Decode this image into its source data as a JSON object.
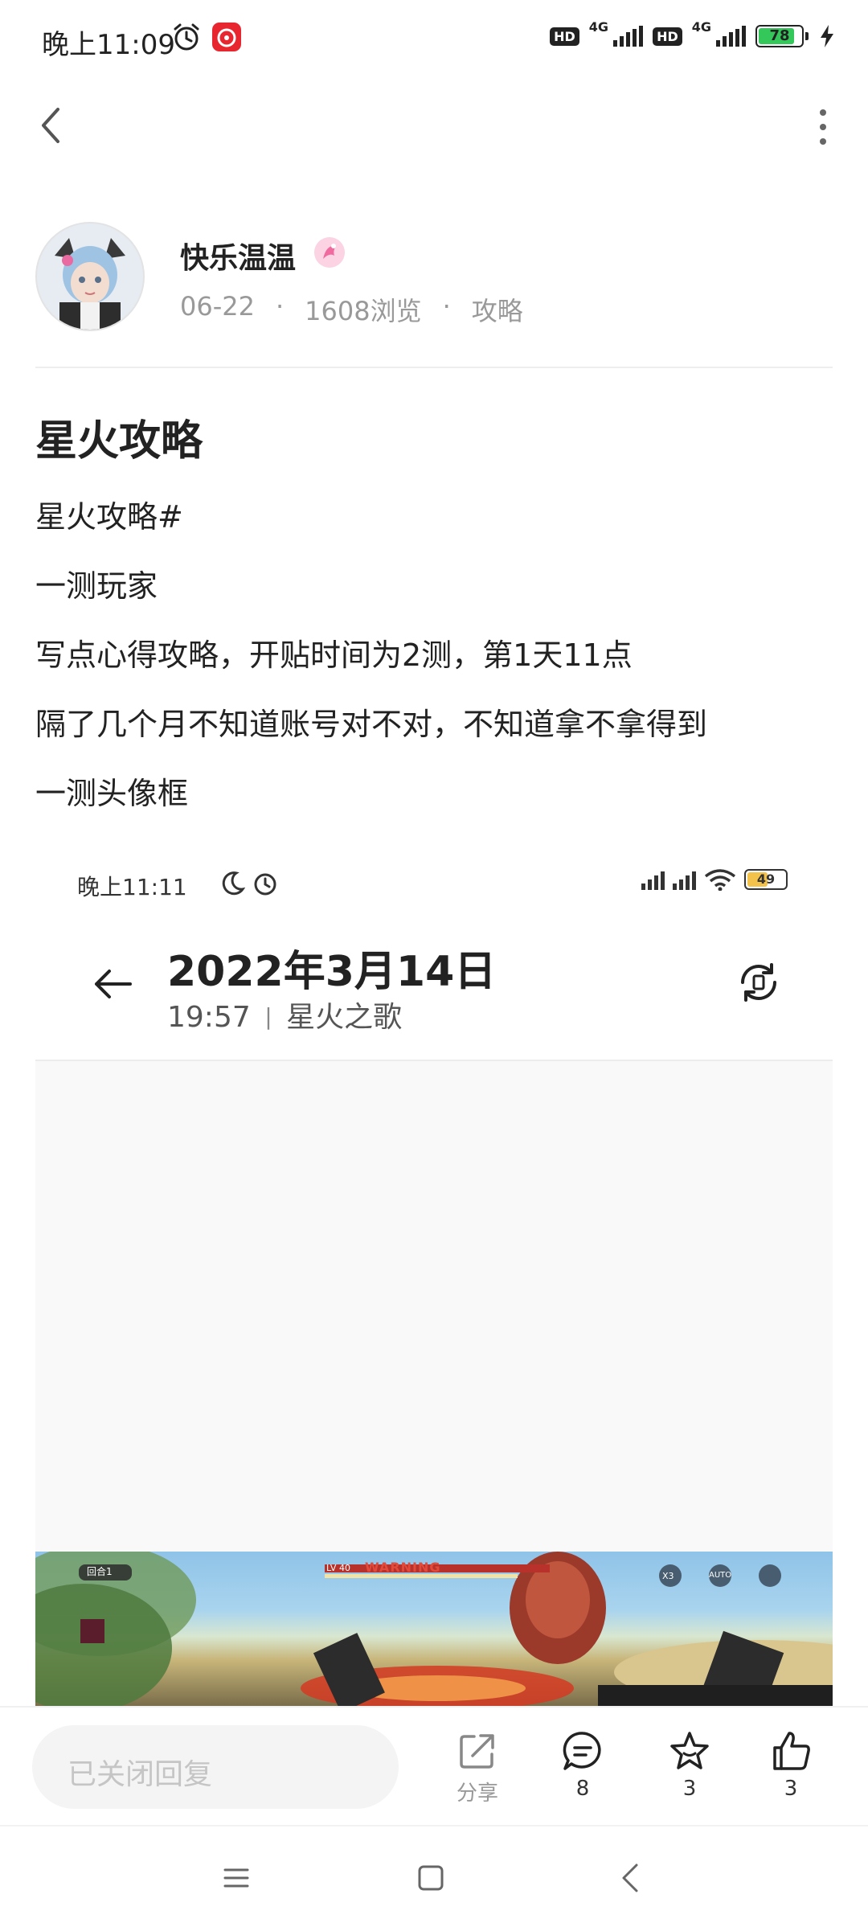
{
  "status_bar": {
    "time": "晚上11:09",
    "network_badge": "HD",
    "network_type": "4G",
    "battery": "78"
  },
  "author": {
    "name": "快乐温温",
    "date": "06-22",
    "views": "1608浏览",
    "category": "攻略",
    "separator": "·"
  },
  "post": {
    "title": "星火攻略",
    "paragraphs": [
      "星火攻略#",
      "一测玩家",
      "写点心得攻略，开贴时间为2测，第1天11点",
      "隔了几个月不知道账号对不对，不知道拿不拿得到",
      "一测头像框"
    ]
  },
  "embedded": {
    "time": "晚上11:11",
    "battery": "49",
    "title": "2022年3月14日",
    "subtitle_time": "19:57",
    "subtitle_sep": "|",
    "subtitle_app": "星火之歌",
    "game_hud_round": "回合1",
    "game_hud_level": "LV 40",
    "game_hud_warning": "WARNING",
    "game_hud_x3": "X3",
    "game_hud_auto": "AUTO"
  },
  "bottom_bar": {
    "reply_placeholder": "已关闭回复",
    "share_label": "分享",
    "comments": "8",
    "favorites": "3",
    "likes": "3"
  },
  "colors": {
    "primary_text": "#222222",
    "secondary_text": "#999999",
    "battery_green": "#34c759",
    "battery_yellow": "#f3c24a"
  }
}
